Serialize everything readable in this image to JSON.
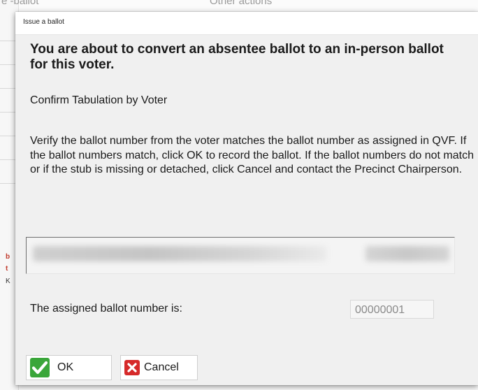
{
  "background": {
    "top_fragment_left": "e  -ballot",
    "top_fragment_right": "Other actions",
    "side_marks": [
      "b",
      "t",
      "K"
    ]
  },
  "dialog": {
    "title": "Issue a ballot",
    "heading": "You are about to convert an absentee ballot to an in-person ballot for this voter.",
    "subheading": "Confirm Tabulation by Voter",
    "instructions": "Verify the ballot number from the voter matches the ballot number as assigned in QVF.  If the ballot numbers match, click OK to record the ballot.  If the ballot numbers do not match or if the stub is missing or detached, click Cancel and contact the Precinct Chairperson.",
    "assigned_label": "The assigned ballot number is:",
    "assigned_value": "00000001",
    "ok_label": "OK",
    "cancel_label": "Cancel"
  },
  "colors": {
    "ok_icon": "#3aa63a",
    "cancel_icon": "#d62a2a",
    "dialog_bg": "#f0f0f0"
  },
  "icons": {
    "ok": "checkmark-icon",
    "cancel": "x-icon"
  }
}
